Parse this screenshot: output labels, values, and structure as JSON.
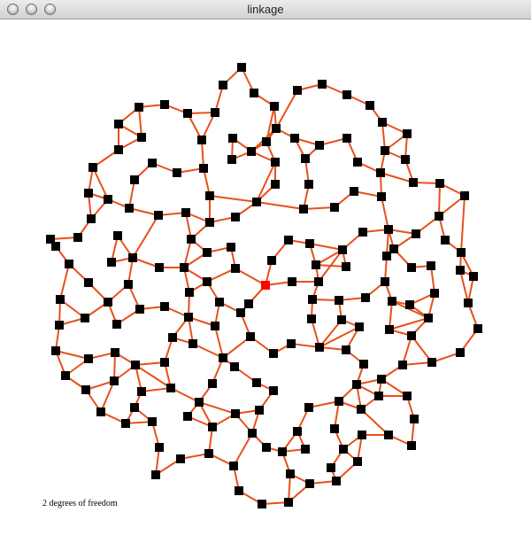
{
  "window": {
    "title": "linkage"
  },
  "buttons": {
    "close_icon": "close-icon",
    "minimize_icon": "minimize-icon",
    "zoom_icon": "zoom-icon"
  },
  "colors": {
    "link": "#e8501a",
    "joint": "#000000",
    "driver_joint": "#ff0000",
    "background": "#ffffff"
  },
  "status": {
    "text": "2 degrees of freedom"
  }
}
